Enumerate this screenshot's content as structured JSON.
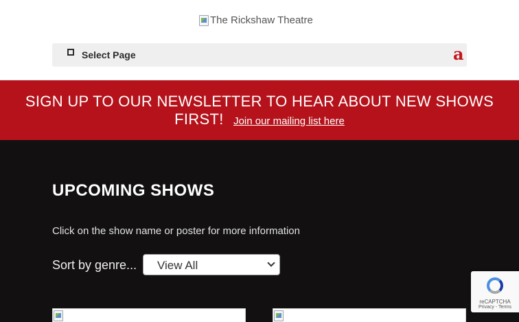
{
  "header": {
    "logo_alt": "The Rickshaw Theatre",
    "menu_label": "Select Page",
    "menu_icon": "a"
  },
  "banner": {
    "text": "SIGN UP TO OUR NEWSLETTER TO HEAR ABOUT NEW SHOWS FIRST!",
    "link": "Join our mailing list here"
  },
  "shows": {
    "title": "UPCOMING SHOWS",
    "hint": "Click on the show name or poster for more information",
    "sort_label": "Sort by genre...",
    "sort_value": "View All"
  },
  "recaptcha": {
    "label": "reCAPTCHA",
    "links": "Privacy - Terms"
  },
  "colors": {
    "brand_red": "#b5121b",
    "dark_bg": "#121010"
  }
}
